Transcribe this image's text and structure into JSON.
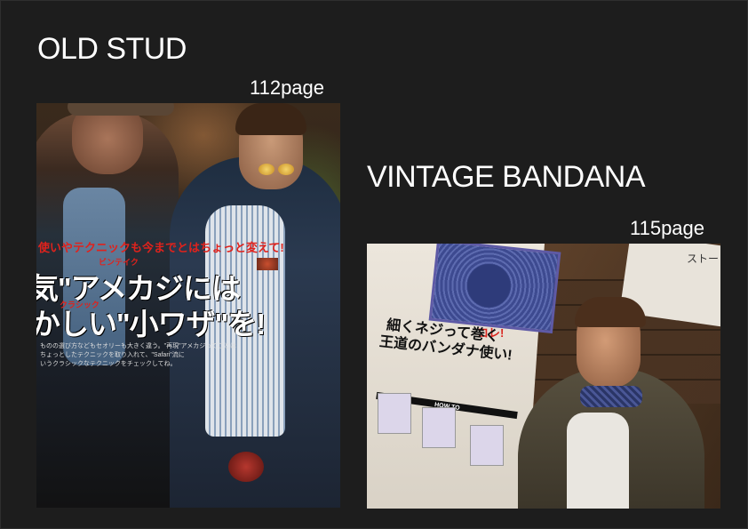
{
  "sections": [
    {
      "title": "OLD STUD",
      "page": "112page"
    },
    {
      "title": "VINTAGE BANDANA",
      "page": "115page"
    }
  ],
  "photo1": {
    "lines": [
      {
        "text": "使いやテクニックも今までとはちょっと変えて!",
        "style": "red"
      },
      {
        "text": "気\"アメカジには",
        "style": "big"
      },
      {
        "text": "かしい\"小ワザ\"を!",
        "style": "big"
      }
    ],
    "badges": [
      "ビンテイク",
      "クラシック"
    ],
    "small_text": [
      "ものの選び方などもセオリーも大きく違う。\"再現\"アメカジってことは",
      "ちょっとしたテクニックを取り入れて、\"Safari\"流に",
      "いうクラシックなテクニックをチェックしてね。"
    ]
  },
  "photo2": {
    "heading_lines": [
      "細くネジって巻く",
      "王道のバンダナ使い!"
    ],
    "red_label": "コレ!",
    "howto": "HOW TO",
    "corner_text": "ストー"
  }
}
